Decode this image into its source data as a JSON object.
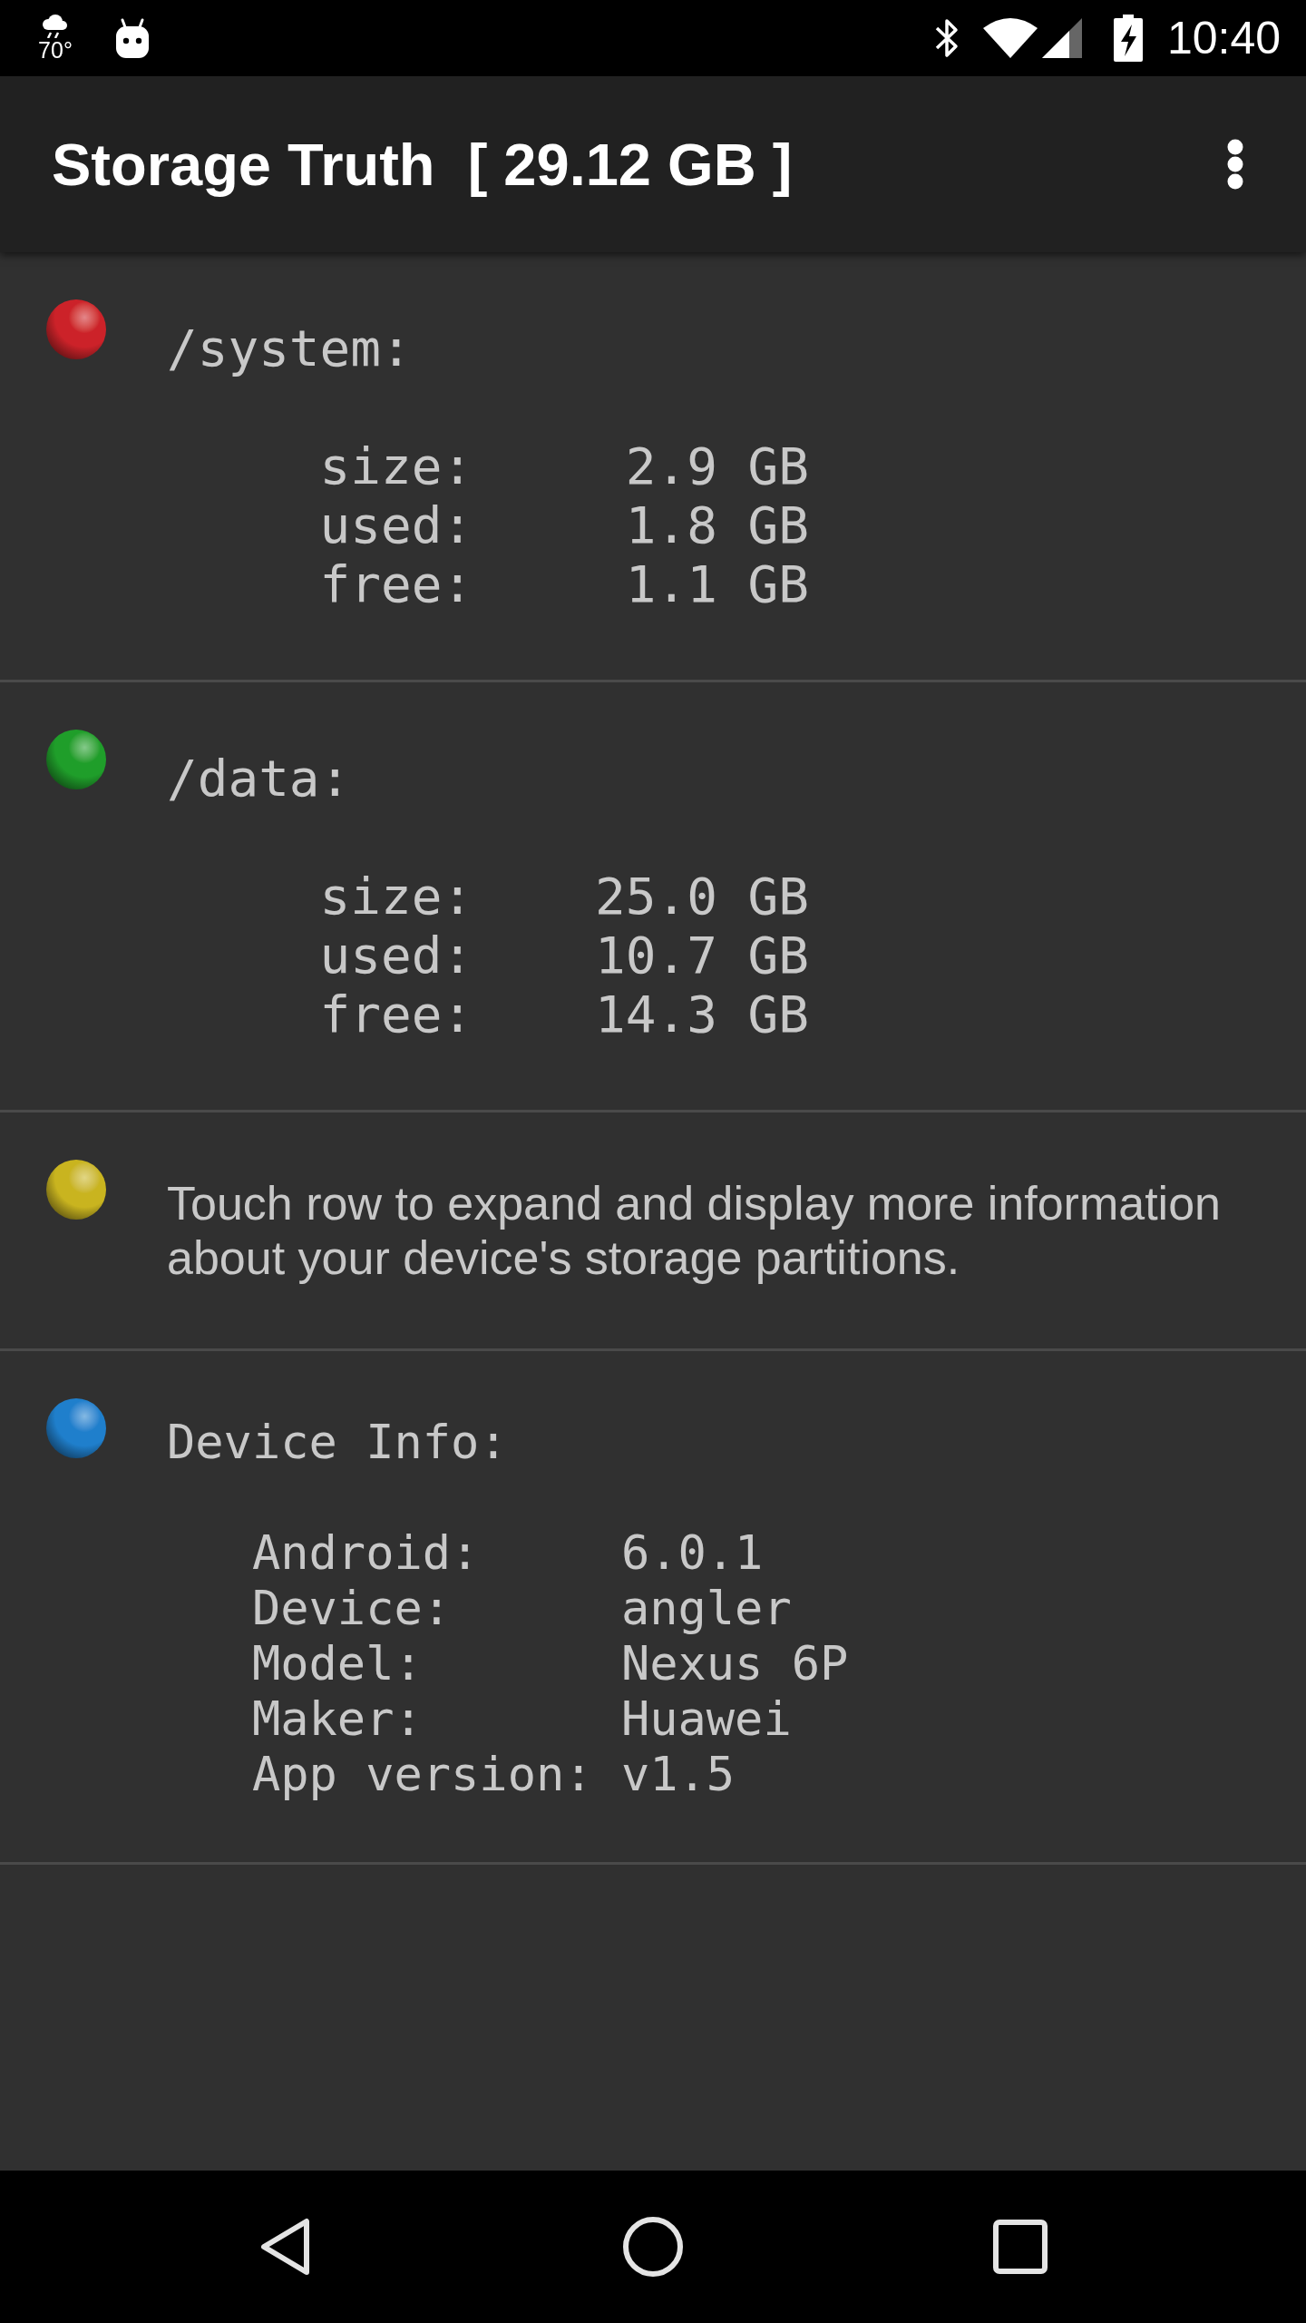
{
  "status_bar": {
    "temperature": "70°",
    "time": "10:40"
  },
  "app_bar": {
    "title": "Storage Truth  [ 29.12 GB ]"
  },
  "rows": [
    {
      "kind": "partition",
      "color": "#cc2229",
      "heading": "/system:",
      "fields": [
        {
          "label": "size:",
          "value": "2.9 GB"
        },
        {
          "label": "used:",
          "value": "1.8 GB"
        },
        {
          "label": "free:",
          "value": "1.1 GB"
        }
      ]
    },
    {
      "kind": "partition",
      "color": "#1f9e2a",
      "heading": "/data:",
      "fields": [
        {
          "label": "size:",
          "value": "25.0 GB"
        },
        {
          "label": "used:",
          "value": "10.7 GB"
        },
        {
          "label": "free:",
          "value": "14.3 GB"
        }
      ]
    },
    {
      "kind": "hint",
      "color": "#c9b41f",
      "text": "Touch row to expand and display more information about your device's storage partitions."
    },
    {
      "kind": "device",
      "color": "#1f7fcc",
      "heading": "Device Info:",
      "fields": [
        {
          "label": "Android:",
          "value": "6.0.1"
        },
        {
          "label": "Device:",
          "value": "angler"
        },
        {
          "label": "Model:",
          "value": "Nexus 6P"
        },
        {
          "label": "Maker:",
          "value": "Huawei"
        },
        {
          "label": "App version:",
          "value": "v1.5"
        }
      ]
    }
  ]
}
